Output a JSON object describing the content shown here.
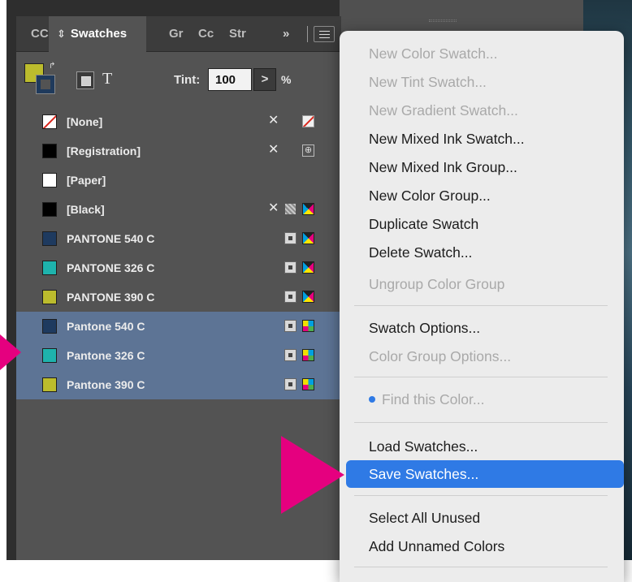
{
  "tabs": {
    "tab_cc": "CC",
    "tab_swatches": "Swatches",
    "tab_gr": "Gr",
    "tab_cc2": "Cc",
    "tab_str": "Str",
    "overflow": "»"
  },
  "toolbar": {
    "text_toggle": "T",
    "tint_label": "Tint:",
    "tint_value": "100",
    "tint_step": ">",
    "percent": "%"
  },
  "swatches": [
    {
      "name": "[None]",
      "color": "#ffffff"
    },
    {
      "name": "[Registration]",
      "color": "#000000"
    },
    {
      "name": "[Paper]",
      "color": "#ffffff"
    },
    {
      "name": "[Black]",
      "color": "#000000"
    },
    {
      "name": "PANTONE 540 C",
      "color": "#1e3a5f"
    },
    {
      "name": "PANTONE 326 C",
      "color": "#1eb3ad"
    },
    {
      "name": "PANTONE 390 C",
      "color": "#bcbc2d"
    },
    {
      "name": "Pantone 540 C",
      "color": "#1e3a5f",
      "selected": true
    },
    {
      "name": "Pantone 326 C",
      "color": "#1eb3ad",
      "selected": true
    },
    {
      "name": "Pantone 390 C",
      "color": "#bcbc2d",
      "selected": true
    }
  ],
  "menu": {
    "new_color_swatch": "New Color Swatch...",
    "new_tint_swatch": "New Tint Swatch...",
    "new_gradient_swatch": "New Gradient Swatch...",
    "new_mixed_ink_swatch": "New Mixed Ink Swatch...",
    "new_mixed_ink_group": "New Mixed Ink Group...",
    "new_color_group": "New Color Group...",
    "duplicate_swatch": "Duplicate Swatch",
    "delete_swatch": "Delete Swatch...",
    "ungroup_color_group": "Ungroup Color Group",
    "swatch_options": "Swatch Options...",
    "color_group_options": "Color Group Options...",
    "find_this_color": "Find this Color...",
    "load_swatches": "Load Swatches...",
    "save_swatches": "Save Swatches...",
    "select_all_unused": "Select All Unused",
    "add_unnamed_colors": "Add Unnamed Colors"
  },
  "colors": {
    "highlight": "#2f7ae5",
    "pointer": "#e5007f",
    "selection": "#5d7495"
  }
}
